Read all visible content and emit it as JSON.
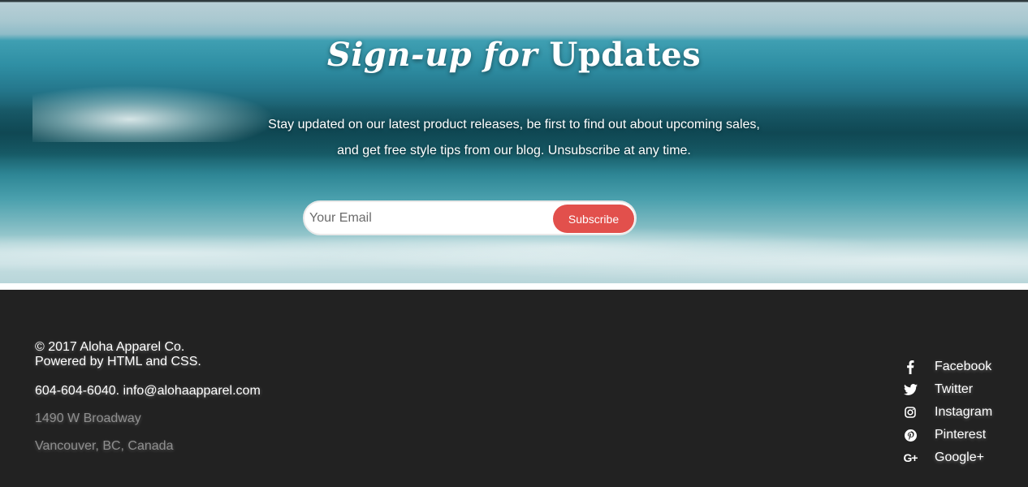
{
  "signup": {
    "title_italic": "Sign-up for",
    "title_rest": "Updates",
    "description_line1": "Stay updated on our latest product releases, be first to find out about upcoming sales,",
    "description_line2": "and get free style tips from our blog. Unsubscribe at any time.",
    "email_placeholder": "Your Email",
    "email_value": "",
    "subscribe_label": "Subscribe"
  },
  "footer": {
    "copyright": "© 2017 Aloha Apparel Co.",
    "powered_by": "Powered by HTML and CSS.",
    "contact": "604-604-6040. info@alohaapparel.com",
    "address_line1": "1490 W Broadway",
    "address_line2": "Vancouver, BC, Canada"
  },
  "social": [
    {
      "label": "Facebook",
      "icon": "facebook-icon"
    },
    {
      "label": "Twitter",
      "icon": "twitter-icon"
    },
    {
      "label": "Instagram",
      "icon": "instagram-icon"
    },
    {
      "label": "Pinterest",
      "icon": "pinterest-icon"
    },
    {
      "label": "Google+",
      "icon": "google-plus-icon"
    }
  ],
  "colors": {
    "accent": "#e2504c",
    "footer_bg": "#222222",
    "muted_text": "#8f8f8f"
  }
}
